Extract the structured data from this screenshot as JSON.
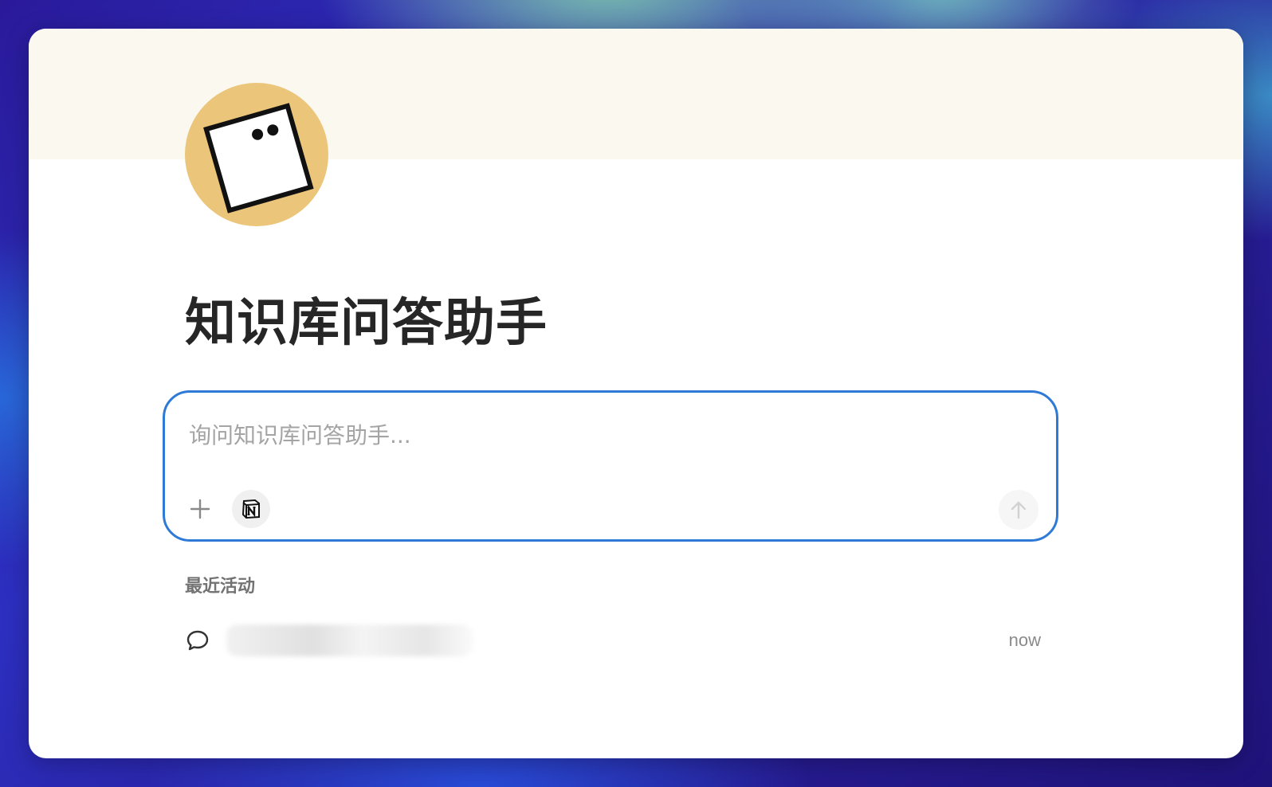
{
  "page": {
    "title": "知识库问答助手",
    "avatar_icon": "square-face-icon"
  },
  "chat": {
    "placeholder": "询问知识库问答助手...",
    "add_icon": "plus-icon",
    "source_icon": "notion-icon",
    "send_icon": "arrow-up-icon",
    "accent_color": "#2e7ad6"
  },
  "recent": {
    "heading": "最近活动",
    "items": [
      {
        "icon": "chat-bubble-icon",
        "title": "",
        "time": "now"
      }
    ]
  }
}
